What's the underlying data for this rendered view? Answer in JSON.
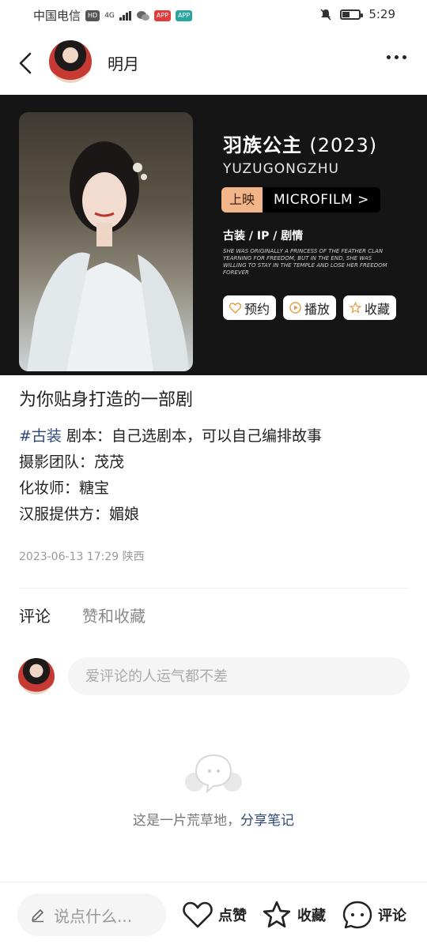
{
  "status_bar": {
    "carrier": "中国电信",
    "hd": "HD",
    "network": "4G",
    "time": "5:29"
  },
  "header": {
    "author_name": "明月"
  },
  "poster": {
    "title": "羽族公主",
    "year": "(2023)",
    "pinyin": "YUZUGONGZHU",
    "status": "上映",
    "type": "MICROFILM >",
    "tags": "古装 / IP / 剧情",
    "description": "SHE WAS ORIGINALLY A PRINCESS OF THE FEATHER CLAN YEARNING FOR FREEDOM, BUT IN THE END, SHE WAS WILLING TO STAY IN THE TEMPLE AND LOSE HER FREEDOM FOREVER",
    "btn_reserve": "预约",
    "btn_play": "播放",
    "btn_collect": "收藏"
  },
  "note": {
    "title": "为你贴身打造的一部剧",
    "hashtag": "#古装",
    "line1": "剧本：自己选剧本，可以自己编排故事",
    "line2": "摄影团队：茂茂",
    "line3": "化妆师：糖宝",
    "line4": "汉服提供方：媚娘",
    "meta": "2023-06-13 17:29 陕西"
  },
  "tabs": {
    "comments": "评论",
    "likes": "赞和收藏"
  },
  "comment_input": {
    "placeholder": "爱评论的人运气都不差"
  },
  "empty_state": {
    "text": "这是一片荒草地，",
    "link": "分享笔记"
  },
  "bottom_bar": {
    "say_placeholder": "说点什么...",
    "like": "点赞",
    "collect": "收藏",
    "comment": "评论"
  },
  "colors": {
    "accent_link": "#2f4a7a",
    "pill_on": "#f2b58a",
    "poster_bg": "#151515"
  },
  "icons": [
    "back-arrow-icon",
    "more-dots-icon",
    "heart-icon",
    "play-icon",
    "star-icon",
    "pencil-icon",
    "chat-icon"
  ]
}
